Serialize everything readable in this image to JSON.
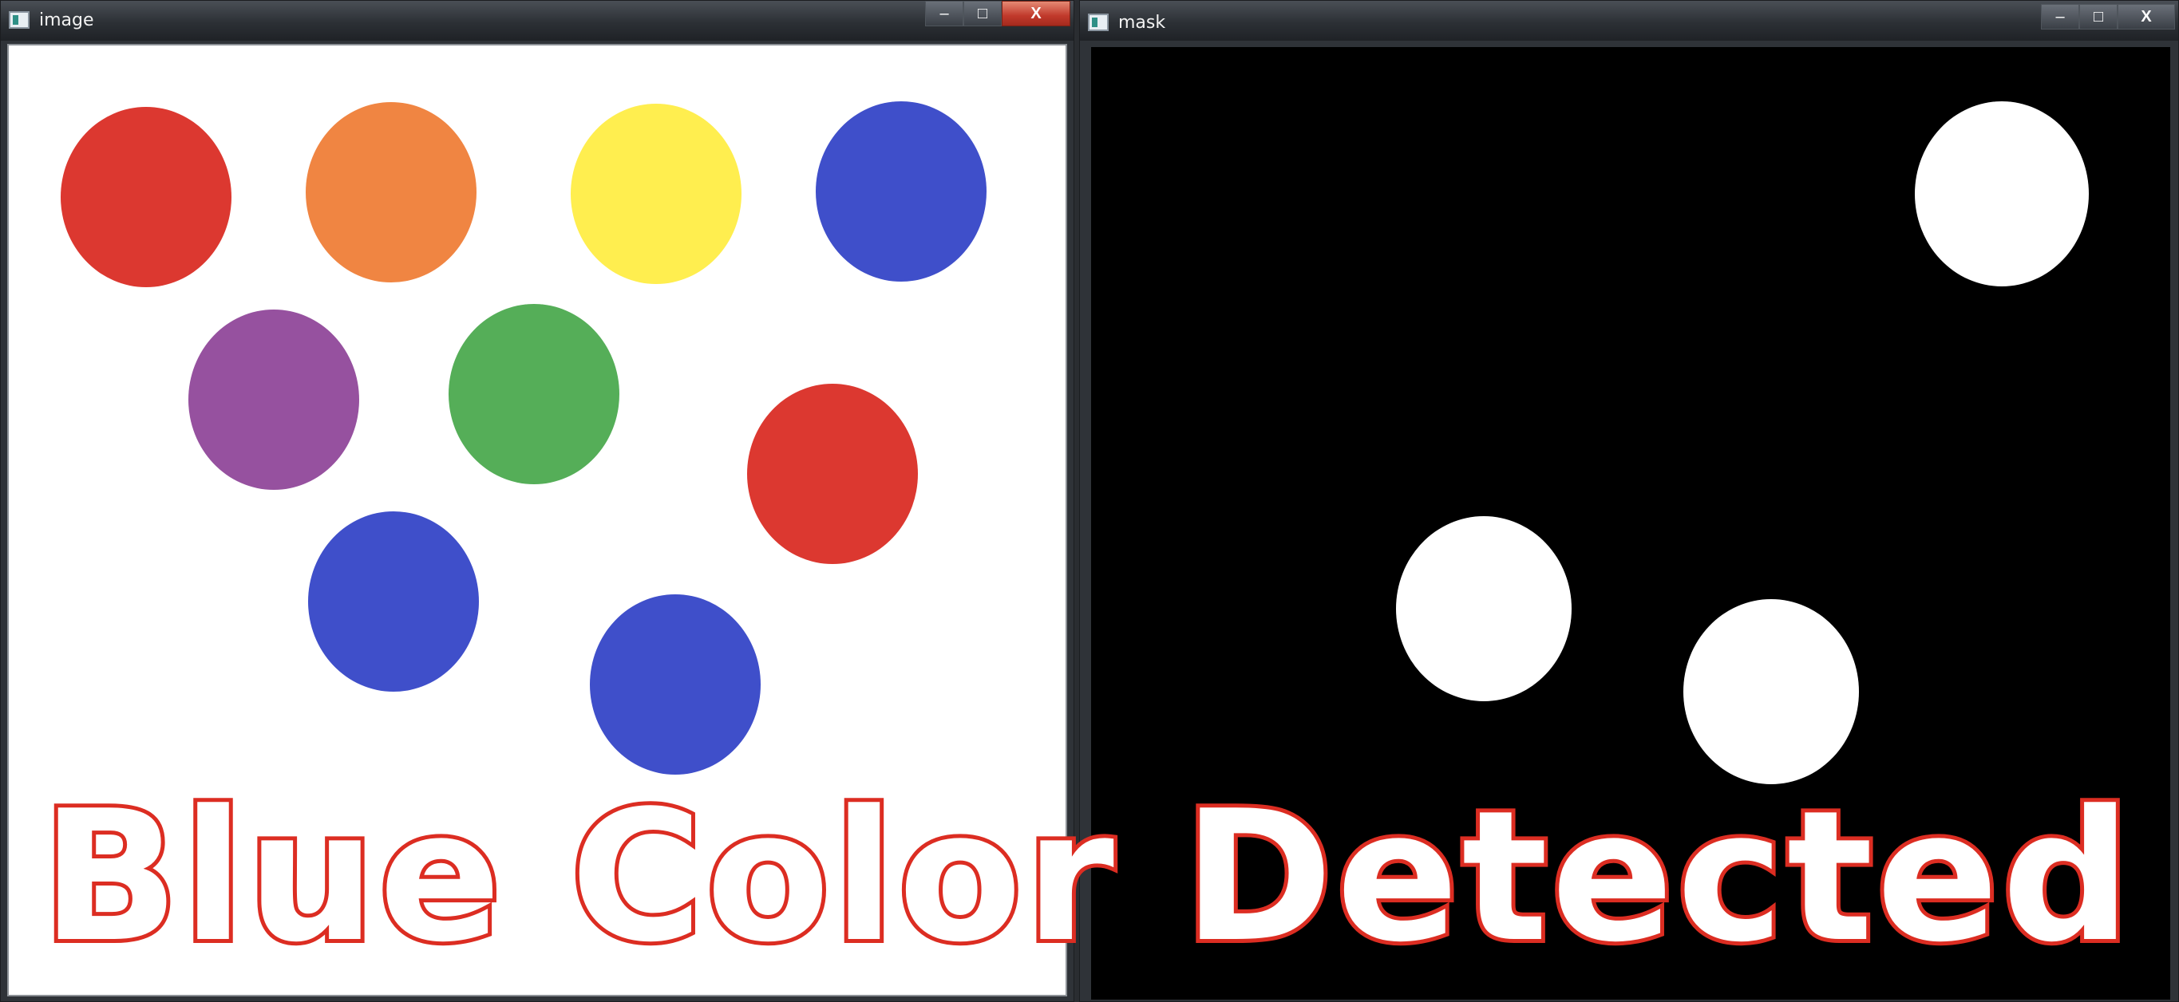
{
  "windows": {
    "image": {
      "title": "image"
    },
    "mask": {
      "title": "mask"
    }
  },
  "caption_buttons": {
    "minimize": "–",
    "maximize": "□",
    "close": "X"
  },
  "image_window": {
    "circles": [
      {
        "color": "#dc3830",
        "icon": "red-circle"
      },
      {
        "color": "#f08542",
        "icon": "orange-circle"
      },
      {
        "color": "#ffee4f",
        "icon": "yellow-circle"
      },
      {
        "color": "#3f4fca",
        "icon": "blue-circle"
      },
      {
        "color": "#96519f",
        "icon": "purple-circle"
      },
      {
        "color": "#55ae58",
        "icon": "green-circle"
      },
      {
        "color": "#dc3830",
        "icon": "red-circle"
      },
      {
        "color": "#3f4fca",
        "icon": "blue-circle"
      },
      {
        "color": "#3f4fca",
        "icon": "blue-circle"
      }
    ]
  },
  "mask_window": {
    "blobs": [
      {
        "color": "#ffffff",
        "icon": "white-mask-blob"
      },
      {
        "color": "#ffffff",
        "icon": "white-mask-blob"
      },
      {
        "color": "#ffffff",
        "icon": "white-mask-blob"
      }
    ]
  },
  "overlay": {
    "text": "Blue Color Detected",
    "fill_color": "#ffffff",
    "stroke_color": "#dc2d22"
  }
}
